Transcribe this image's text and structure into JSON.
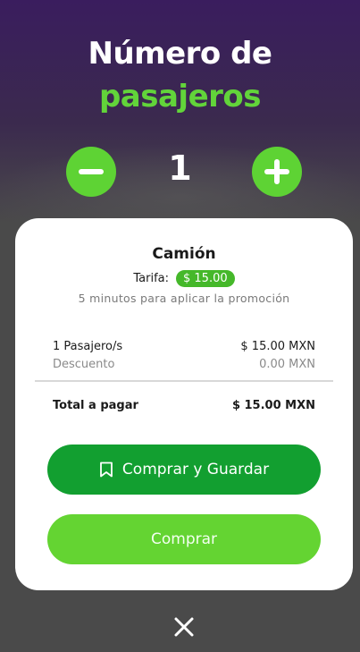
{
  "header": {
    "title_line1": "Número de",
    "title_line2": "pasajeros"
  },
  "stepper": {
    "count": "1"
  },
  "card": {
    "vehicle": "Camión",
    "tarifa_label": "Tarifa:",
    "tarifa_value": "$ 15.00",
    "promo_text": "5 minutos para aplicar la promoción",
    "passengers_label": "1 Pasajero/s",
    "passengers_amount": "$ 15.00 MXN",
    "discount_label": "Descuento",
    "discount_amount": "0.00 MXN",
    "total_label": "Total a pagar",
    "total_amount": "$ 15.00 MXN"
  },
  "buttons": {
    "buy_and_save": "Comprar y Guardar",
    "buy": "Comprar"
  },
  "colors": {
    "accent_green": "#62d43a",
    "dark_green": "#129f30",
    "background_purple": "#3a1d5e"
  },
  "icons": {
    "minus": "minus-icon",
    "plus": "plus-icon",
    "bookmark": "bookmark-icon",
    "close": "close-icon"
  }
}
